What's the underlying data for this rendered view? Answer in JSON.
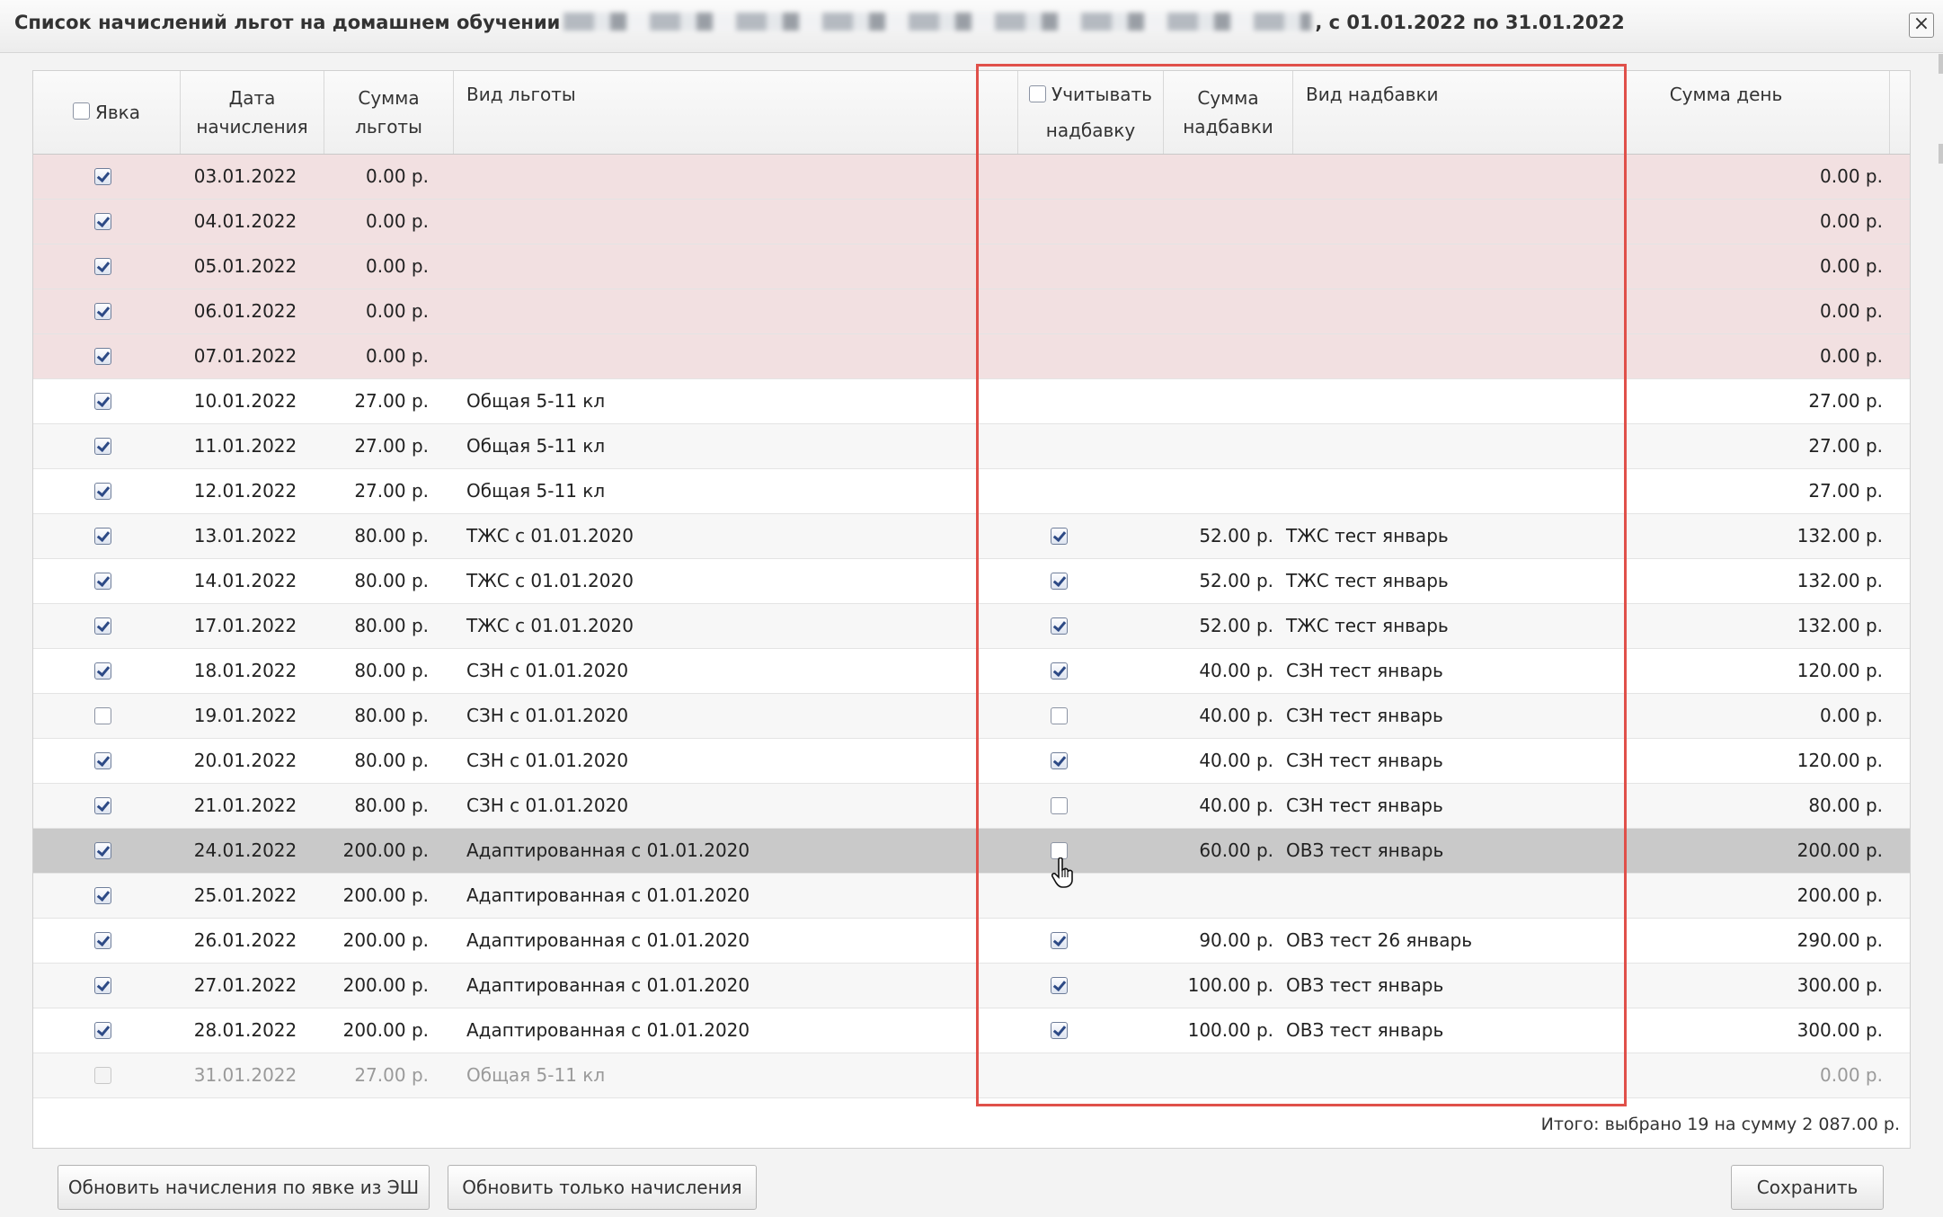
{
  "window": {
    "title_prefix": "Список начислений льгот на домашнем обучении",
    "title_suffix": ", с 01.01.2022 по 31.01.2022",
    "close_label": "×"
  },
  "columns": {
    "attendance": "Явка",
    "date": "Дата начисления",
    "benefit_sum": "Сумма льготы",
    "benefit_kind": "Вид льготы",
    "include_bonus": "Учитывать надбавку",
    "bonus_sum": "Сумма надбавки",
    "bonus_kind": "Вид надбавки",
    "day_sum": "Сумма день"
  },
  "rows": [
    {
      "attendance": true,
      "date": "03.01.2022",
      "benefit_sum": "0.00 р.",
      "benefit_kind": "",
      "include_bonus": null,
      "bonus_sum": "",
      "bonus_kind": "",
      "day_sum": "0.00 р.",
      "style": "pink"
    },
    {
      "attendance": true,
      "date": "04.01.2022",
      "benefit_sum": "0.00 р.",
      "benefit_kind": "",
      "include_bonus": null,
      "bonus_sum": "",
      "bonus_kind": "",
      "day_sum": "0.00 р.",
      "style": "pink"
    },
    {
      "attendance": true,
      "date": "05.01.2022",
      "benefit_sum": "0.00 р.",
      "benefit_kind": "",
      "include_bonus": null,
      "bonus_sum": "",
      "bonus_kind": "",
      "day_sum": "0.00 р.",
      "style": "pink"
    },
    {
      "attendance": true,
      "date": "06.01.2022",
      "benefit_sum": "0.00 р.",
      "benefit_kind": "",
      "include_bonus": null,
      "bonus_sum": "",
      "bonus_kind": "",
      "day_sum": "0.00 р.",
      "style": "pink"
    },
    {
      "attendance": true,
      "date": "07.01.2022",
      "benefit_sum": "0.00 р.",
      "benefit_kind": "",
      "include_bonus": null,
      "bonus_sum": "",
      "bonus_kind": "",
      "day_sum": "0.00 р.",
      "style": "pink"
    },
    {
      "attendance": true,
      "date": "10.01.2022",
      "benefit_sum": "27.00 р.",
      "benefit_kind": "Общая 5-11 кл",
      "include_bonus": null,
      "bonus_sum": "",
      "bonus_kind": "",
      "day_sum": "27.00 р.",
      "style": ""
    },
    {
      "attendance": true,
      "date": "11.01.2022",
      "benefit_sum": "27.00 р.",
      "benefit_kind": "Общая 5-11 кл",
      "include_bonus": null,
      "bonus_sum": "",
      "bonus_kind": "",
      "day_sum": "27.00 р.",
      "style": "alt"
    },
    {
      "attendance": true,
      "date": "12.01.2022",
      "benefit_sum": "27.00 р.",
      "benefit_kind": "Общая 5-11 кл",
      "include_bonus": null,
      "bonus_sum": "",
      "bonus_kind": "",
      "day_sum": "27.00 р.",
      "style": ""
    },
    {
      "attendance": true,
      "date": "13.01.2022",
      "benefit_sum": "80.00 р.",
      "benefit_kind": "ТЖС с 01.01.2020",
      "include_bonus": true,
      "bonus_sum": "52.00 р.",
      "bonus_kind": "ТЖС тест январь",
      "day_sum": "132.00 р.",
      "style": "alt"
    },
    {
      "attendance": true,
      "date": "14.01.2022",
      "benefit_sum": "80.00 р.",
      "benefit_kind": "ТЖС с 01.01.2020",
      "include_bonus": true,
      "bonus_sum": "52.00 р.",
      "bonus_kind": "ТЖС тест январь",
      "day_sum": "132.00 р.",
      "style": ""
    },
    {
      "attendance": true,
      "date": "17.01.2022",
      "benefit_sum": "80.00 р.",
      "benefit_kind": "ТЖС с 01.01.2020",
      "include_bonus": true,
      "bonus_sum": "52.00 р.",
      "bonus_kind": "ТЖС тест январь",
      "day_sum": "132.00 р.",
      "style": "alt"
    },
    {
      "attendance": true,
      "date": "18.01.2022",
      "benefit_sum": "80.00 р.",
      "benefit_kind": "СЗН с 01.01.2020",
      "include_bonus": true,
      "bonus_sum": "40.00 р.",
      "bonus_kind": "СЗН тест январь",
      "day_sum": "120.00 р.",
      "style": ""
    },
    {
      "attendance": false,
      "date": "19.01.2022",
      "benefit_sum": "80.00 р.",
      "benefit_kind": "СЗН с 01.01.2020",
      "include_bonus": false,
      "bonus_sum": "40.00 р.",
      "bonus_kind": "СЗН тест январь",
      "day_sum": "0.00 р.",
      "style": "alt"
    },
    {
      "attendance": true,
      "date": "20.01.2022",
      "benefit_sum": "80.00 р.",
      "benefit_kind": "СЗН с 01.01.2020",
      "include_bonus": true,
      "bonus_sum": "40.00 р.",
      "bonus_kind": "СЗН тест январь",
      "day_sum": "120.00 р.",
      "style": ""
    },
    {
      "attendance": true,
      "date": "21.01.2022",
      "benefit_sum": "80.00 р.",
      "benefit_kind": "СЗН с 01.01.2020",
      "include_bonus": false,
      "bonus_sum": "40.00 р.",
      "bonus_kind": "СЗН тест январь",
      "day_sum": "80.00 р.",
      "style": "alt"
    },
    {
      "attendance": true,
      "date": "24.01.2022",
      "benefit_sum": "200.00 р.",
      "benefit_kind": "Адаптированная с 01.01.2020",
      "include_bonus": false,
      "bonus_sum": "60.00 р.",
      "bonus_kind": "ОВЗ тест январь",
      "day_sum": "200.00 р.",
      "style": "sel"
    },
    {
      "attendance": true,
      "date": "25.01.2022",
      "benefit_sum": "200.00 р.",
      "benefit_kind": "Адаптированная с 01.01.2020",
      "include_bonus": null,
      "bonus_sum": "",
      "bonus_kind": "",
      "day_sum": "200.00 р.",
      "style": "alt"
    },
    {
      "attendance": true,
      "date": "26.01.2022",
      "benefit_sum": "200.00 р.",
      "benefit_kind": "Адаптированная с 01.01.2020",
      "include_bonus": true,
      "bonus_sum": "90.00 р.",
      "bonus_kind": "ОВЗ тест 26 январь",
      "day_sum": "290.00 р.",
      "style": ""
    },
    {
      "attendance": true,
      "date": "27.01.2022",
      "benefit_sum": "200.00 р.",
      "benefit_kind": "Адаптированная с 01.01.2020",
      "include_bonus": true,
      "bonus_sum": "100.00 р.",
      "bonus_kind": "ОВЗ тест январь",
      "day_sum": "300.00 р.",
      "style": "alt"
    },
    {
      "attendance": true,
      "date": "28.01.2022",
      "benefit_sum": "200.00 р.",
      "benefit_kind": "Адаптированная с 01.01.2020",
      "include_bonus": true,
      "bonus_sum": "100.00 р.",
      "bonus_kind": "ОВЗ тест январь",
      "day_sum": "300.00 р.",
      "style": ""
    },
    {
      "attendance": "disabled",
      "date": "31.01.2022",
      "benefit_sum": "27.00 р.",
      "benefit_kind": "Общая 5-11 кл",
      "include_bonus": null,
      "bonus_sum": "",
      "bonus_kind": "",
      "day_sum": "0.00 р.",
      "style": "alt dis"
    }
  ],
  "footer": {
    "total": "Итого: выбрано 19 на сумму 2 087.00 р.",
    "refresh_from_attendance": "Обновить начисления по явке из ЭШ",
    "refresh_only": "Обновить только начисления",
    "save": "Сохранить"
  },
  "colors": {
    "highlight": "#e0504a",
    "weekend_row": "#f2e0e1",
    "selected_row": "#c9c9c9"
  }
}
